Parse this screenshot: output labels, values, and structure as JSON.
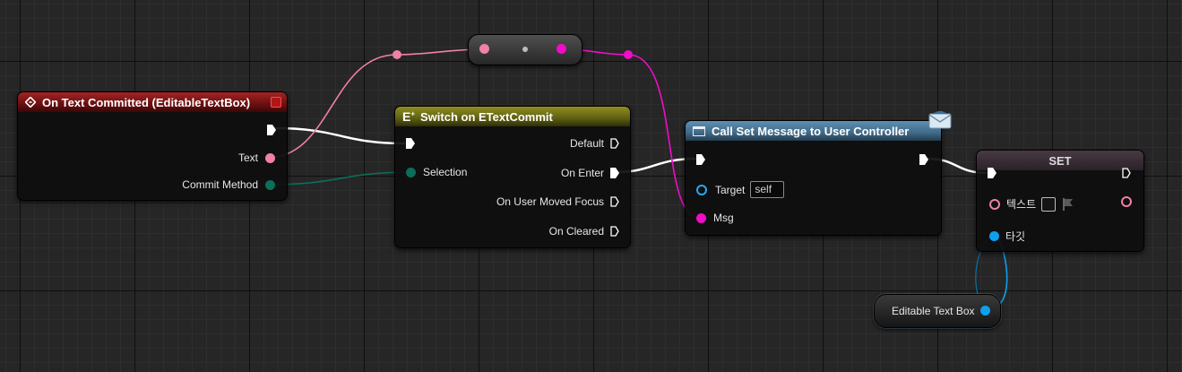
{
  "graph": {
    "event_node": {
      "title": "On Text Committed (EditableTextBox)",
      "pins": {
        "text": "Text",
        "commit_method": "Commit Method"
      },
      "header_color": "#a32424"
    },
    "switch_node": {
      "title": "Switch on ETextCommit",
      "pins": {
        "selection": "Selection",
        "default": "Default",
        "on_enter": "On Enter",
        "on_user_moved_focus": "On User Moved Focus",
        "on_cleared": "On Cleared"
      },
      "header_color": "#8f8f22"
    },
    "call_node": {
      "title": "Call Set Message to User Controller",
      "pins": {
        "target": "Target",
        "target_value": "self",
        "msg": "Msg"
      },
      "header_color": "#5f8fb0"
    },
    "set_node": {
      "title": "SET",
      "pins": {
        "text": "텍스트",
        "target": "타깃"
      }
    },
    "getter_node": {
      "label": "Editable Text Box"
    },
    "pin_colors": {
      "exec": "#ffffff",
      "text": "#ee82a6",
      "string": "#f10cc8",
      "enum": "#0c6e5a",
      "object": "#0da0ee"
    },
    "icons": [
      "event-diamond-icon",
      "close-icon",
      "enum-switch-icon",
      "function-icon",
      "message-envelope-icon",
      "pin-flag-icon"
    ]
  }
}
